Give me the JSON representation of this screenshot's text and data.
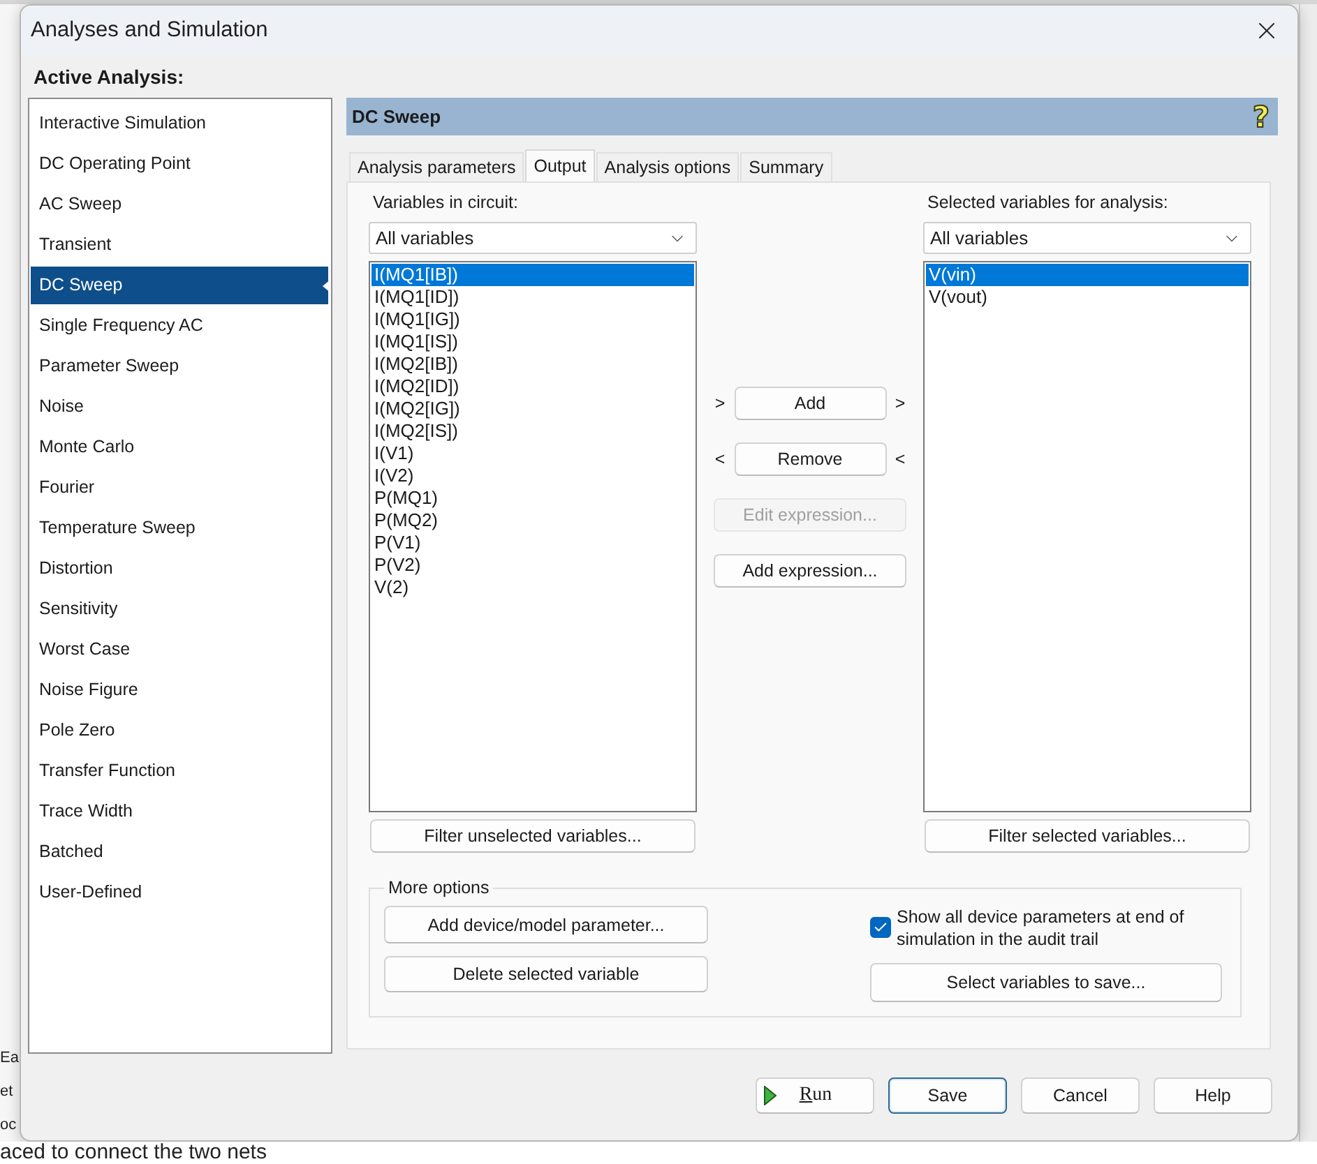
{
  "background": {
    "side_texts": [
      "Ea",
      "et",
      "oc"
    ],
    "status_text": "aced to connect the two nets"
  },
  "window": {
    "title": "Analyses and Simulation"
  },
  "sidebar": {
    "title": "Active Analysis:",
    "items": [
      {
        "label": "Interactive Simulation",
        "selected": false
      },
      {
        "label": "DC Operating Point",
        "selected": false
      },
      {
        "label": "AC Sweep",
        "selected": false
      },
      {
        "label": "Transient",
        "selected": false
      },
      {
        "label": "DC Sweep",
        "selected": true
      },
      {
        "label": "Single Frequency AC",
        "selected": false
      },
      {
        "label": "Parameter Sweep",
        "selected": false
      },
      {
        "label": "Noise",
        "selected": false
      },
      {
        "label": "Monte Carlo",
        "selected": false
      },
      {
        "label": "Fourier",
        "selected": false
      },
      {
        "label": "Temperature Sweep",
        "selected": false
      },
      {
        "label": "Distortion",
        "selected": false
      },
      {
        "label": "Sensitivity",
        "selected": false
      },
      {
        "label": "Worst Case",
        "selected": false
      },
      {
        "label": "Noise Figure",
        "selected": false
      },
      {
        "label": "Pole Zero",
        "selected": false
      },
      {
        "label": "Transfer Function",
        "selected": false
      },
      {
        "label": "Trace Width",
        "selected": false
      },
      {
        "label": "Batched",
        "selected": false
      },
      {
        "label": "User-Defined",
        "selected": false
      }
    ]
  },
  "panel": {
    "title": "DC Sweep",
    "help": "?"
  },
  "tabs": [
    {
      "label": "Analysis parameters",
      "selected": false
    },
    {
      "label": "Output",
      "selected": true
    },
    {
      "label": "Analysis options",
      "selected": false
    },
    {
      "label": "Summary",
      "selected": false
    }
  ],
  "circuit_variables": {
    "label": "Variables in circuit:",
    "filter": "All variables",
    "items": [
      {
        "label": "I(MQ1[IB])",
        "selected": true
      },
      {
        "label": "I(MQ1[ID])",
        "selected": false
      },
      {
        "label": "I(MQ1[IG])",
        "selected": false
      },
      {
        "label": "I(MQ1[IS])",
        "selected": false
      },
      {
        "label": "I(MQ2[IB])",
        "selected": false
      },
      {
        "label": "I(MQ2[ID])",
        "selected": false
      },
      {
        "label": "I(MQ2[IG])",
        "selected": false
      },
      {
        "label": "I(MQ2[IS])",
        "selected": false
      },
      {
        "label": "I(V1)",
        "selected": false
      },
      {
        "label": "I(V2)",
        "selected": false
      },
      {
        "label": "P(MQ1)",
        "selected": false
      },
      {
        "label": "P(MQ2)",
        "selected": false
      },
      {
        "label": "P(V1)",
        "selected": false
      },
      {
        "label": "P(V2)",
        "selected": false
      },
      {
        "label": "V(2)",
        "selected": false
      }
    ],
    "button": "Filter unselected variables..."
  },
  "transfer": [
    {
      "label": "Add",
      "marker_left": ">",
      "marker_right": ">"
    },
    {
      "label": "Remove",
      "marker_left": "<",
      "marker_right": "<"
    }
  ],
  "expression_buttons": [
    {
      "label": "Edit expression...",
      "disabled": true
    },
    {
      "label": "Add expression...",
      "disabled": false
    }
  ],
  "selected_variables": {
    "label": "Selected variables for analysis:",
    "filter": "All variables",
    "items": [
      {
        "label": "V(vin)",
        "selected": true
      },
      {
        "label": "V(vout)",
        "selected": false
      }
    ],
    "button": "Filter selected variables..."
  },
  "more_options": {
    "title": "More options",
    "buttons": [
      "Add device/model parameter...",
      "Delete selected variable"
    ],
    "checkbox": {
      "label": "Show all device parameters at end of simulation in the audit trail",
      "checked": true
    },
    "save_button": "Select variables to save..."
  },
  "footer_buttons": [
    {
      "label": "Run",
      "kind": "run",
      "mnemonic": true,
      "focused": false
    },
    {
      "label": "Save",
      "kind": "plain",
      "mnemonic": false,
      "focused": true
    },
    {
      "label": "Cancel",
      "kind": "plain",
      "mnemonic": false,
      "focused": false
    },
    {
      "label": "Help",
      "kind": "plain",
      "mnemonic": false,
      "focused": false
    }
  ]
}
